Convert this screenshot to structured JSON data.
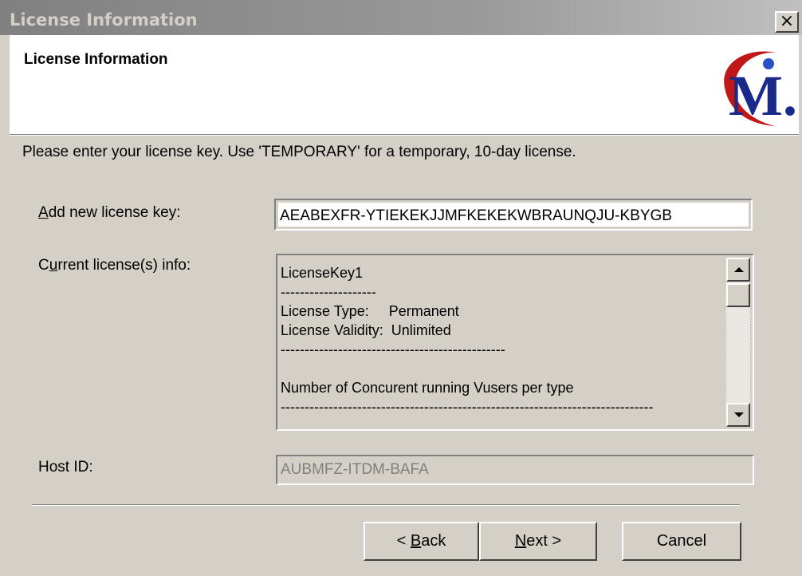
{
  "window": {
    "title": "License Information",
    "close_glyph": "×"
  },
  "header": {
    "title": "License Information",
    "logo_icon": "mercury-m-logo",
    "logo_letter": "M.",
    "logo_colors": {
      "swoosh": "#c01818",
      "letter": "#1a2a8a",
      "dot": "#2a50c8"
    }
  },
  "instruction": "Please enter your license key. Use 'TEMPORARY' for a temporary, 10-day license.",
  "new_key": {
    "label_pre": "",
    "label_accel": "A",
    "label_post": "dd new license key:",
    "value": "AEABEXFR-YTIEKEKJJMFKEKEKWBRAUNQJU-KBYGB"
  },
  "current_info": {
    "label_pre": "C",
    "label_accel": "u",
    "label_post": "rrent license(s) info:",
    "lines": [
      "LicenseKey1",
      "--------------------",
      "License Type:     Permanent",
      "License Validity:  Unlimited",
      "-----------------------------------------------",
      "",
      "Number of Concurent running Vusers per type",
      "------------------------------------------------------------------------------"
    ],
    "scroll_up_icon": "scroll-up-arrow-icon",
    "scroll_down_icon": "scroll-down-arrow-icon"
  },
  "host": {
    "label": "Host ID:",
    "value": "AUBMFZ-ITDM-BAFA"
  },
  "buttons": {
    "back_pre": "< ",
    "back_accel": "B",
    "back_post": "ack",
    "next_accel": "N",
    "next_post": "ext >",
    "cancel": "Cancel"
  }
}
